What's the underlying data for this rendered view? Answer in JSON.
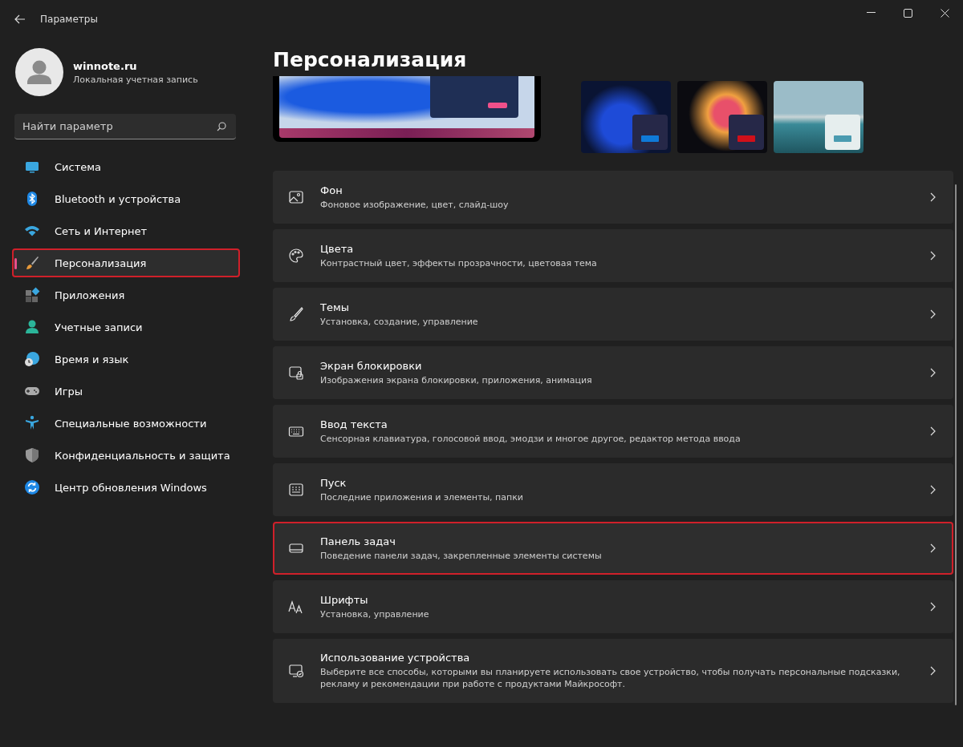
{
  "window": {
    "title": "Параметры"
  },
  "account": {
    "name": "winnote.ru",
    "type": "Локальная учетная запись"
  },
  "search": {
    "placeholder": "Найти параметр"
  },
  "sidebar": {
    "items": [
      {
        "label": "Система",
        "selected": false,
        "highlighted": false
      },
      {
        "label": "Bluetooth и устройства",
        "selected": false,
        "highlighted": false
      },
      {
        "label": "Сеть и Интернет",
        "selected": false,
        "highlighted": false
      },
      {
        "label": "Персонализация",
        "selected": true,
        "highlighted": true
      },
      {
        "label": "Приложения",
        "selected": false,
        "highlighted": false
      },
      {
        "label": "Учетные записи",
        "selected": false,
        "highlighted": false
      },
      {
        "label": "Время и язык",
        "selected": false,
        "highlighted": false
      },
      {
        "label": "Игры",
        "selected": false,
        "highlighted": false
      },
      {
        "label": "Специальные возможности",
        "selected": false,
        "highlighted": false
      },
      {
        "label": "Конфиденциальность и защита",
        "selected": false,
        "highlighted": false
      },
      {
        "label": "Центр обновления Windows",
        "selected": false,
        "highlighted": false
      }
    ]
  },
  "page": {
    "title": "Персонализация"
  },
  "themes": [
    {
      "color": "#0f7ad8"
    },
    {
      "color": "#d0101a"
    },
    {
      "color": "#4a9bb0"
    }
  ],
  "settings": [
    {
      "title": "Фон",
      "description": "Фоновое изображение, цвет, слайд-шоу",
      "highlighted": false
    },
    {
      "title": "Цвета",
      "description": "Контрастный цвет, эффекты прозрачности, цветовая тема",
      "highlighted": false
    },
    {
      "title": "Темы",
      "description": "Установка, создание, управление",
      "highlighted": false
    },
    {
      "title": "Экран блокировки",
      "description": "Изображения экрана блокировки, приложения, анимация",
      "highlighted": false
    },
    {
      "title": "Ввод текста",
      "description": "Сенсорная клавиатура, голосовой ввод, эмодзи и многое другое, редактор метода ввода",
      "highlighted": false
    },
    {
      "title": "Пуск",
      "description": "Последние приложения и элементы, папки",
      "highlighted": false
    },
    {
      "title": "Панель задач",
      "description": "Поведение панели задач, закрепленные элементы системы",
      "highlighted": true
    },
    {
      "title": "Шрифты",
      "description": "Установка, управление",
      "highlighted": false
    },
    {
      "title": "Использование устройства",
      "description": "Выберите все способы, которыми вы планируете использовать свое устройство, чтобы получать персональные подсказки, рекламу и рекомендации при работе с продуктами Майкрософт.",
      "highlighted": false
    }
  ]
}
